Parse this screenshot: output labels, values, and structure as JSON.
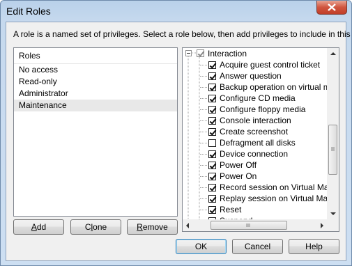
{
  "window": {
    "title": "Edit Roles"
  },
  "instruction": "A role is a named set of privileges. Select a role below, then add privileges to include in this role.",
  "roles": {
    "header": "Roles",
    "items": [
      "No access",
      "Read-only",
      "Administrator",
      "Maintenance"
    ],
    "selected": "Maintenance"
  },
  "privileges": {
    "group": {
      "label": "Interaction",
      "state": "partial"
    },
    "items": [
      {
        "label": "Acquire guest control ticket",
        "checked": true
      },
      {
        "label": "Answer question",
        "checked": true
      },
      {
        "label": "Backup operation on virtual mac",
        "checked": true
      },
      {
        "label": "Configure CD media",
        "checked": true
      },
      {
        "label": "Configure floppy media",
        "checked": true
      },
      {
        "label": "Console interaction",
        "checked": true
      },
      {
        "label": "Create screenshot",
        "checked": true
      },
      {
        "label": "Defragment all disks",
        "checked": false
      },
      {
        "label": "Device connection",
        "checked": true
      },
      {
        "label": "Power Off",
        "checked": true
      },
      {
        "label": "Power On",
        "checked": true
      },
      {
        "label": "Record session on Virtual Machin",
        "checked": true
      },
      {
        "label": "Replay session on Virtual Machin",
        "checked": true
      },
      {
        "label": "Reset",
        "checked": true
      },
      {
        "label": "Suspend",
        "checked": false
      }
    ]
  },
  "buttons": {
    "add": {
      "pre": "",
      "accel": "A",
      "post": "dd"
    },
    "clone": {
      "pre": "C",
      "accel": "l",
      "post": "one"
    },
    "remove": {
      "pre": "",
      "accel": "R",
      "post": "emove"
    },
    "ok": "OK",
    "cancel": "Cancel",
    "help": "Help"
  },
  "colors": {
    "close_button": "#c9452f",
    "selection": "#e8e8e8",
    "default_border": "#3c7fb1"
  }
}
